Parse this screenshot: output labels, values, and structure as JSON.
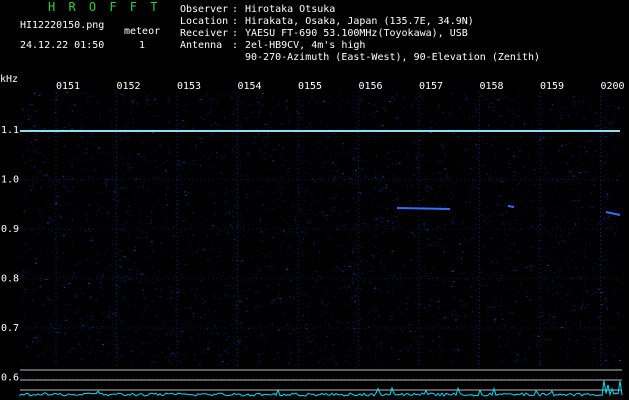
{
  "header": {
    "app_title": "H R O F F T",
    "file_name": "HI12220150.png",
    "meteor_label": "meteor",
    "datetime": "24.12.22 01:50",
    "meteor_count": "1"
  },
  "info": [
    {
      "key": "Observer",
      "sep": ":",
      "value": "Hirotaka Otsuka"
    },
    {
      "key": "Location",
      "sep": ":",
      "value": "Hirakata, Osaka, Japan (135.7E, 34.9N)"
    },
    {
      "key": "Receiver",
      "sep": ":",
      "value": "YAESU FT-690 53.100MHz(Toyokawa), USB"
    },
    {
      "key": "Antenna",
      "sep": ":",
      "value": "2el-HB9CV, 4m's high"
    },
    {
      "key": "",
      "sep": "",
      "value": "90-270-Azimuth (East-West), 90-Elevation (Zenith)"
    }
  ],
  "axis": {
    "unit": "kHz",
    "time_ticks": [
      "0151",
      "0152",
      "0153",
      "0154",
      "0155",
      "0156",
      "0157",
      "0158",
      "0159",
      "0200"
    ],
    "freq_ticks": [
      "1.1",
      "1.0",
      "0.9",
      "0.8",
      "0.7",
      "0.6"
    ]
  },
  "colors": {
    "background": "#000000",
    "title_green": "#33cc33",
    "carrier": "#7fe8ff",
    "tick_blue": "#2233cc",
    "noise_blue": "#0a0a55",
    "level_cyan": "#00e0ff"
  }
}
